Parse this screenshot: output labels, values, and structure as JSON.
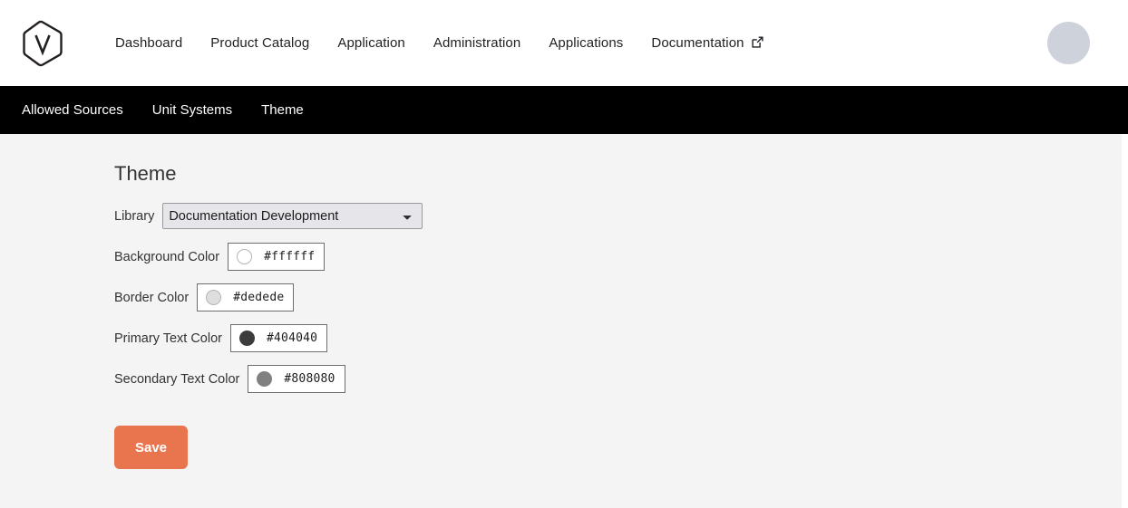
{
  "header": {
    "logo_icon": "hexagon-v-logo",
    "nav": [
      {
        "label": "Dashboard",
        "icon": null
      },
      {
        "label": "Product Catalog",
        "icon": null
      },
      {
        "label": "Application",
        "icon": null
      },
      {
        "label": "Administration",
        "icon": null
      },
      {
        "label": "Applications",
        "icon": null
      },
      {
        "label": "Documentation",
        "icon": "external-link-icon"
      }
    ],
    "avatar_label": ""
  },
  "subnav": {
    "items": [
      {
        "label": "Allowed Sources"
      },
      {
        "label": "Unit Systems"
      },
      {
        "label": "Theme"
      }
    ]
  },
  "main": {
    "title": "Theme",
    "library": {
      "label": "Library",
      "selected": "Documentation Development",
      "options": [
        "Documentation Development"
      ]
    },
    "colors": [
      {
        "label": "Background Color",
        "value": "#ffffff",
        "swatch": "#ffffff"
      },
      {
        "label": "Border Color",
        "value": "#dedede",
        "swatch": "#dedede"
      },
      {
        "label": "Primary Text Color",
        "value": "#404040",
        "swatch": "#404040"
      },
      {
        "label": "Secondary Text Color",
        "value": "#808080",
        "swatch": "#808080"
      }
    ],
    "save_label": "Save"
  },
  "theme": {
    "accent": "#e8754d",
    "subnav_bg": "#000000",
    "content_bg": "#f4f4f4"
  }
}
